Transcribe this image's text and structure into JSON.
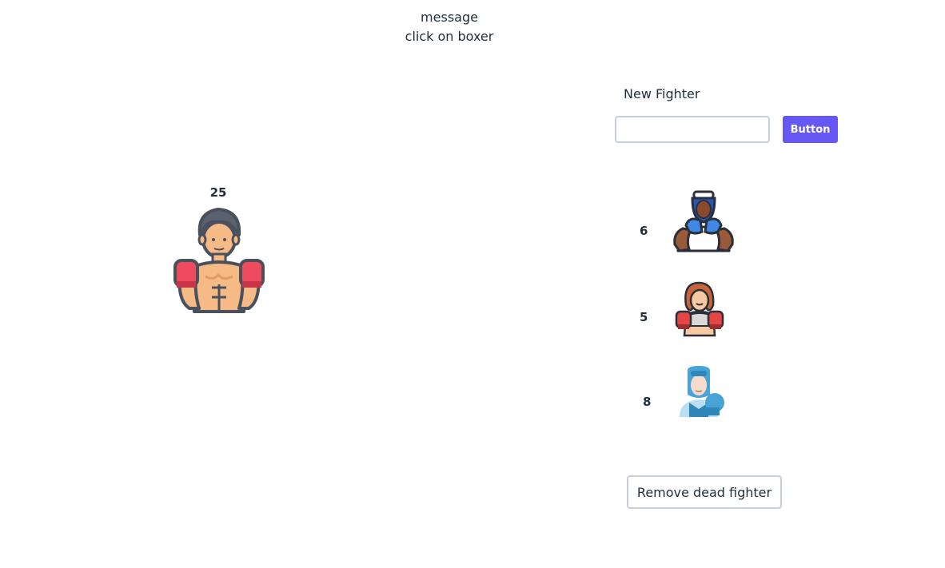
{
  "message": {
    "heading": "message",
    "text": "click on boxer"
  },
  "main_fighter": {
    "hp": "25",
    "icon": "shirtless-boxer-icon"
  },
  "new_fighter": {
    "label": "New Fighter",
    "input_value": "",
    "button_label": "Button",
    "button_color": "#6558f5"
  },
  "roster": [
    {
      "hp": "6",
      "icon": "boxer-blue-headgear-icon"
    },
    {
      "hp": "5",
      "icon": "female-boxer-icon"
    },
    {
      "hp": "8",
      "icon": "boxer-light-blue-headgear-icon"
    }
  ],
  "remove_button_label": "Remove dead fighter"
}
